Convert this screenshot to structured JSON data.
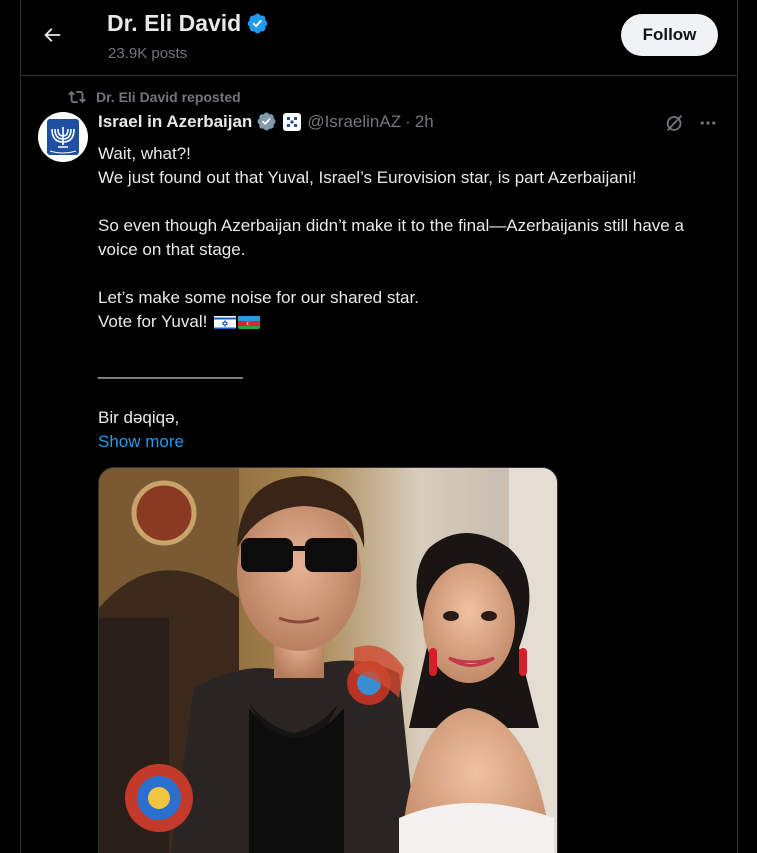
{
  "header": {
    "name": "Dr. Eli David",
    "posts_count": "23.9K posts",
    "follow_label": "Follow"
  },
  "repost": {
    "text": "Dr. Eli David reposted"
  },
  "tweet": {
    "author_name": "Israel in Azerbaijan",
    "handle": "@IsraelinAZ",
    "separator": "·",
    "time": "2h",
    "lines": {
      "l1": "Wait, what?!",
      "l2": "We just found out that Yuval, Israel’s Eurovision star, is part Azerbaijani!",
      "l3": "So even though Azerbaijan didn’t make it to the final—Azerbaijanis still have a voice on that stage.",
      "l4": "Let’s make some noise for our shared star.",
      "l5": "Vote for Yuval!",
      "divider": "_________________",
      "l6": "Bir dəqiqə,"
    },
    "show_more": "Show more",
    "flags": [
      "israel-flag-icon",
      "azerbaijan-flag-icon"
    ]
  },
  "colors": {
    "background": "#000000",
    "text": "#e7e9ea",
    "secondary": "#71767b",
    "link": "#1d9bf0",
    "verified": "#1d9bf0",
    "border": "#2f3336"
  }
}
